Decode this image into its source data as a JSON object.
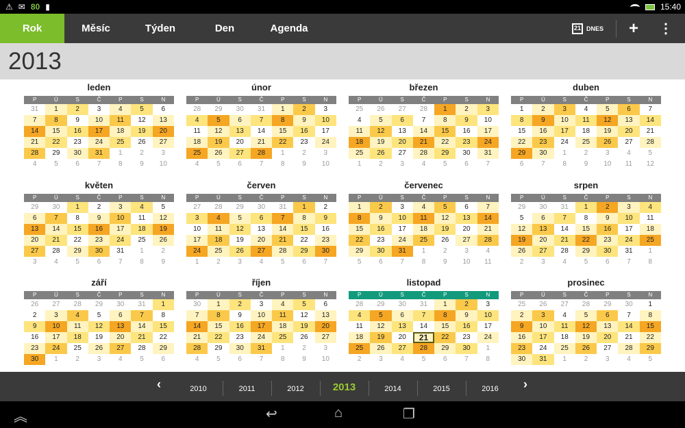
{
  "status": {
    "battery_level": "80",
    "time": "15:40",
    "icons": [
      "warning-icon",
      "mail-icon",
      "sd-card-icon",
      "wifi-icon",
      "battery-icon"
    ]
  },
  "toolbar": {
    "tabs": [
      "Rok",
      "Měsíc",
      "Týden",
      "Den",
      "Agenda"
    ],
    "active_tab": "Rok",
    "today_day": "21",
    "today_label": "DNES",
    "add_label": "+",
    "menu_label": "⋮"
  },
  "year": "2013",
  "weekdays": [
    "P",
    "Ú",
    "S",
    "Č",
    "P",
    "S",
    "N"
  ],
  "months": [
    {
      "name": "leden",
      "weeks": [
        [
          "31",
          "1",
          "2",
          "3",
          "4",
          "5",
          "6"
        ],
        [
          "7",
          "8",
          "9",
          "10",
          "11",
          "12",
          "13"
        ],
        [
          "14",
          "15",
          "16",
          "17",
          "18",
          "19",
          "20"
        ],
        [
          "21",
          "22",
          "23",
          "24",
          "25",
          "26",
          "27"
        ],
        [
          "28",
          "29",
          "30",
          "31",
          "1",
          "2",
          "3"
        ],
        [
          "4",
          "5",
          "6",
          "7",
          "8",
          "9",
          "10"
        ]
      ]
    },
    {
      "name": "únor",
      "weeks": [
        [
          "28",
          "29",
          "30",
          "31",
          "1",
          "2",
          "3"
        ],
        [
          "4",
          "5",
          "6",
          "7",
          "8",
          "9",
          "10"
        ],
        [
          "11",
          "12",
          "13",
          "14",
          "15",
          "16",
          "17"
        ],
        [
          "18",
          "19",
          "20",
          "21",
          "22",
          "23",
          "24"
        ],
        [
          "25",
          "26",
          "27",
          "28",
          "1",
          "2",
          "3"
        ],
        [
          "4",
          "5",
          "6",
          "7",
          "8",
          "9",
          "10"
        ]
      ]
    },
    {
      "name": "březen",
      "weeks": [
        [
          "25",
          "26",
          "27",
          "28",
          "1",
          "2",
          "3"
        ],
        [
          "4",
          "5",
          "6",
          "7",
          "8",
          "9",
          "10"
        ],
        [
          "11",
          "12",
          "13",
          "14",
          "15",
          "16",
          "17"
        ],
        [
          "18",
          "19",
          "20",
          "21",
          "22",
          "23",
          "24"
        ],
        [
          "25",
          "26",
          "27",
          "28",
          "29",
          "30",
          "31"
        ],
        [
          "1",
          "2",
          "3",
          "4",
          "5",
          "6",
          "7"
        ]
      ]
    },
    {
      "name": "duben",
      "weeks": [
        [
          "1",
          "2",
          "3",
          "4",
          "5",
          "6",
          "7"
        ],
        [
          "8",
          "9",
          "10",
          "11",
          "12",
          "13",
          "14"
        ],
        [
          "15",
          "16",
          "17",
          "18",
          "19",
          "20",
          "21"
        ],
        [
          "22",
          "23",
          "24",
          "25",
          "26",
          "27",
          "28"
        ],
        [
          "29",
          "30",
          "1",
          "2",
          "3",
          "4",
          "5"
        ],
        [
          "6",
          "7",
          "8",
          "9",
          "10",
          "11",
          "12"
        ]
      ]
    },
    {
      "name": "květen",
      "weeks": [
        [
          "29",
          "30",
          "1",
          "2",
          "3",
          "4",
          "5"
        ],
        [
          "6",
          "7",
          "8",
          "9",
          "10",
          "11",
          "12"
        ],
        [
          "13",
          "14",
          "15",
          "16",
          "17",
          "18",
          "19"
        ],
        [
          "20",
          "21",
          "22",
          "23",
          "24",
          "25",
          "26"
        ],
        [
          "27",
          "28",
          "29",
          "30",
          "31",
          "1",
          "2"
        ],
        [
          "3",
          "4",
          "5",
          "6",
          "7",
          "8",
          "9"
        ]
      ]
    },
    {
      "name": "červen",
      "weeks": [
        [
          "27",
          "28",
          "29",
          "30",
          "31",
          "1",
          "2"
        ],
        [
          "3",
          "4",
          "5",
          "6",
          "7",
          "8",
          "9"
        ],
        [
          "10",
          "11",
          "12",
          "13",
          "14",
          "15",
          "16"
        ],
        [
          "17",
          "18",
          "19",
          "20",
          "21",
          "22",
          "23"
        ],
        [
          "24",
          "25",
          "26",
          "27",
          "28",
          "29",
          "30"
        ],
        [
          "1",
          "2",
          "3",
          "4",
          "5",
          "6",
          "7"
        ]
      ]
    },
    {
      "name": "červenec",
      "weeks": [
        [
          "1",
          "2",
          "3",
          "4",
          "5",
          "6",
          "7"
        ],
        [
          "8",
          "9",
          "10",
          "11",
          "12",
          "13",
          "14"
        ],
        [
          "15",
          "16",
          "17",
          "18",
          "19",
          "20",
          "21"
        ],
        [
          "22",
          "23",
          "24",
          "25",
          "26",
          "27",
          "28"
        ],
        [
          "29",
          "30",
          "31",
          "1",
          "2",
          "3",
          "4"
        ],
        [
          "5",
          "6",
          "7",
          "8",
          "9",
          "10",
          "11"
        ]
      ]
    },
    {
      "name": "srpen",
      "weeks": [
        [
          "29",
          "30",
          "31",
          "1",
          "2",
          "3",
          "4"
        ],
        [
          "5",
          "6",
          "7",
          "8",
          "9",
          "10",
          "11"
        ],
        [
          "12",
          "13",
          "14",
          "15",
          "16",
          "17",
          "18"
        ],
        [
          "19",
          "20",
          "21",
          "22",
          "23",
          "24",
          "25"
        ],
        [
          "26",
          "27",
          "28",
          "29",
          "30",
          "31",
          "1"
        ],
        [
          "2",
          "3",
          "4",
          "5",
          "6",
          "7",
          "8"
        ]
      ]
    },
    {
      "name": "září",
      "weeks": [
        [
          "26",
          "27",
          "28",
          "29",
          "30",
          "31",
          "1"
        ],
        [
          "2",
          "3",
          "4",
          "5",
          "6",
          "7",
          "8"
        ],
        [
          "9",
          "10",
          "11",
          "12",
          "13",
          "14",
          "15"
        ],
        [
          "16",
          "17",
          "18",
          "19",
          "20",
          "21",
          "22"
        ],
        [
          "23",
          "24",
          "25",
          "26",
          "27",
          "28",
          "29"
        ],
        [
          "30",
          "1",
          "2",
          "3",
          "4",
          "5",
          "6"
        ]
      ]
    },
    {
      "name": "říjen",
      "weeks": [
        [
          "30",
          "1",
          "2",
          "3",
          "4",
          "5",
          "6"
        ],
        [
          "7",
          "8",
          "9",
          "10",
          "11",
          "12",
          "13"
        ],
        [
          "14",
          "15",
          "16",
          "17",
          "18",
          "19",
          "20"
        ],
        [
          "21",
          "22",
          "23",
          "24",
          "25",
          "26",
          "27"
        ],
        [
          "28",
          "29",
          "30",
          "31",
          "1",
          "2",
          "3"
        ],
        [
          "4",
          "5",
          "6",
          "7",
          "8",
          "9",
          "10"
        ]
      ]
    },
    {
      "name": "listopad",
      "weeks": [
        [
          "28",
          "29",
          "30",
          "31",
          "1",
          "2",
          "3"
        ],
        [
          "4",
          "5",
          "6",
          "7",
          "8",
          "9",
          "10"
        ],
        [
          "11",
          "12",
          "13",
          "14",
          "15",
          "16",
          "17"
        ],
        [
          "18",
          "19",
          "20",
          "21",
          "22",
          "23",
          "24"
        ],
        [
          "25",
          "26",
          "27",
          "28",
          "29",
          "30",
          "1"
        ],
        [
          "2",
          "3",
          "4",
          "5",
          "6",
          "7",
          "8"
        ]
      ]
    },
    {
      "name": "prosinec",
      "weeks": [
        [
          "25",
          "26",
          "27",
          "28",
          "29",
          "30",
          "1"
        ],
        [
          "2",
          "3",
          "4",
          "5",
          "6",
          "7",
          "8"
        ],
        [
          "9",
          "10",
          "11",
          "12",
          "13",
          "14",
          "15"
        ],
        [
          "16",
          "17",
          "18",
          "19",
          "20",
          "21",
          "22"
        ],
        [
          "23",
          "24",
          "25",
          "26",
          "27",
          "28",
          "29"
        ],
        [
          "30",
          "31",
          "1",
          "2",
          "3",
          "4",
          "5"
        ]
      ]
    }
  ],
  "current_month": "listopad",
  "today": "21",
  "heat_colors": [
    "#ffffff",
    "#fff3bf",
    "#fde47d",
    "#fbc94a",
    "#f5a623"
  ],
  "yearbar": {
    "prev_label": "‹",
    "next_label": "›",
    "years": [
      "2010",
      "2011",
      "2012",
      "2013",
      "2014",
      "2015",
      "2016"
    ],
    "current": "2013"
  },
  "navbar": {
    "icons": [
      "collapse-icon",
      "back-icon",
      "home-icon",
      "recent-apps-icon"
    ]
  }
}
